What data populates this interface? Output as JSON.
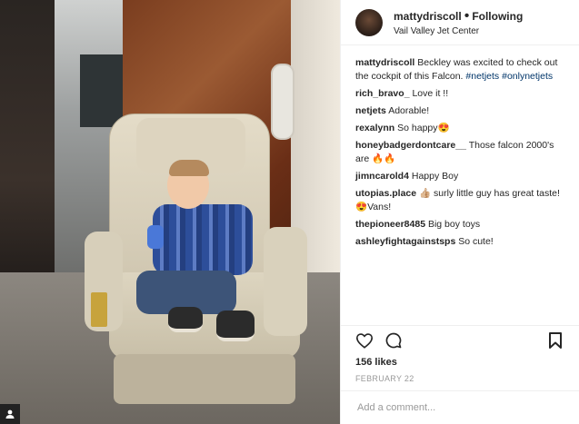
{
  "header": {
    "username": "mattydriscoll",
    "separator": "•",
    "follow_status": "Following",
    "location": "Vail Valley Jet Center"
  },
  "caption": {
    "username": "mattydriscoll",
    "text": "Beckley was excited to check out the cockpit of this Falcon.",
    "hashtags": "#netjets #onlynetjets"
  },
  "comments": [
    {
      "user": "rich_bravo_",
      "text": "Love it !!"
    },
    {
      "user": "netjets",
      "text": "Adorable!"
    },
    {
      "user": "rexalynn",
      "text": "So happy😍"
    },
    {
      "user": "honeybadgerdontcare__",
      "text": "Those falcon 2000's are 🔥🔥"
    },
    {
      "user": "jimncarold4",
      "text": "Happy Boy"
    },
    {
      "user": "utopias.place",
      "text": "👍🏼 surly little guy has great taste! 😍Vans!"
    },
    {
      "user": "thepioneer8485",
      "text": "Big boy toys"
    },
    {
      "user": "ashleyfightagainstsps",
      "text": "So cute!"
    }
  ],
  "actions": {
    "like_icon": "heart-icon",
    "comment_icon": "comment-bubble-icon",
    "save_icon": "bookmark-icon"
  },
  "likes": "156 likes",
  "date": "FEBRUARY 22",
  "add_comment": {
    "placeholder": "Add a comment..."
  },
  "photo": {
    "badge_icon": "person-tag-icon"
  }
}
